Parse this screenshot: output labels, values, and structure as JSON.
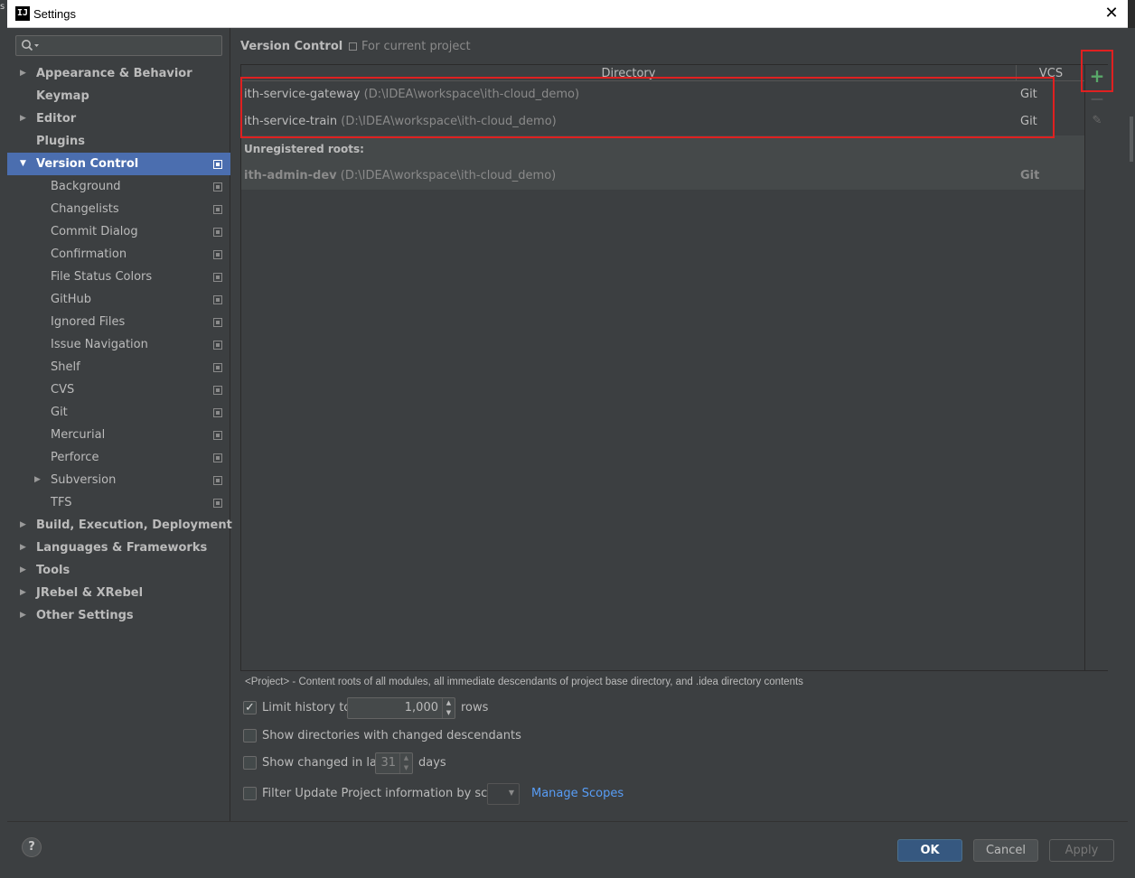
{
  "window": {
    "title": "Settings",
    "icon": "intellij-icon",
    "close": "✕"
  },
  "outer": {
    "left_char": "s"
  },
  "search": {
    "placeholder": "",
    "icon": "search-icon"
  },
  "sidebar": {
    "items": [
      {
        "label": "Appearance & Behavior",
        "expandable": true,
        "bold": true
      },
      {
        "label": "Keymap",
        "expandable": false,
        "bold": true
      },
      {
        "label": "Editor",
        "expandable": true,
        "bold": true
      },
      {
        "label": "Plugins",
        "expandable": false,
        "bold": true
      },
      {
        "label": "Version Control",
        "expanded": true,
        "bold": true,
        "selected": true,
        "project_scope": true
      },
      {
        "label": "Background",
        "child": true,
        "project_scope": true
      },
      {
        "label": "Changelists",
        "child": true,
        "project_scope": true
      },
      {
        "label": "Commit Dialog",
        "child": true,
        "project_scope": true
      },
      {
        "label": "Confirmation",
        "child": true,
        "project_scope": true
      },
      {
        "label": "File Status Colors",
        "child": true,
        "project_scope": true
      },
      {
        "label": "GitHub",
        "child": true,
        "project_scope": true
      },
      {
        "label": "Ignored Files",
        "child": true,
        "project_scope": true
      },
      {
        "label": "Issue Navigation",
        "child": true,
        "project_scope": true
      },
      {
        "label": "Shelf",
        "child": true,
        "project_scope": true
      },
      {
        "label": "CVS",
        "child": true,
        "project_scope": true
      },
      {
        "label": "Git",
        "child": true,
        "project_scope": true
      },
      {
        "label": "Mercurial",
        "child": true,
        "project_scope": true
      },
      {
        "label": "Perforce",
        "child": true,
        "project_scope": true
      },
      {
        "label": "Subversion",
        "child": true,
        "expandable": true,
        "project_scope": true
      },
      {
        "label": "TFS",
        "child": true,
        "project_scope": true
      },
      {
        "label": "Build, Execution, Deployment",
        "expandable": true,
        "bold": true
      },
      {
        "label": "Languages & Frameworks",
        "expandable": true,
        "bold": true
      },
      {
        "label": "Tools",
        "expandable": true,
        "bold": true
      },
      {
        "label": "JRebel & XRebel",
        "expandable": true,
        "bold": true
      },
      {
        "label": "Other Settings",
        "expandable": true,
        "bold": true
      }
    ]
  },
  "content": {
    "title": "Version Control",
    "scope": "For current project",
    "table": {
      "columns": [
        "Directory",
        "VCS"
      ],
      "rows": [
        {
          "name": "ith-service-gateway",
          "path": "(D:\\IDEA\\workspace\\ith-cloud_demo)",
          "vcs": "Git"
        },
        {
          "name": "ith-service-train",
          "path": "(D:\\IDEA\\workspace\\ith-cloud_demo)",
          "vcs": "Git"
        }
      ],
      "unregistered_label": "Unregistered roots:",
      "unregistered": [
        {
          "name": "ith-admin-dev",
          "path": "(D:\\IDEA\\workspace\\ith-cloud_demo)",
          "vcs": "Git"
        }
      ],
      "toolbar": {
        "add": "+",
        "remove": "—",
        "edit": "✎"
      }
    },
    "hint": "<Project> - Content roots of all modules, all immediate descendants of project base directory, and .idea directory contents",
    "options": {
      "limit_history": {
        "label": "Limit history to:",
        "checked": true,
        "value": "1,000",
        "suffix": "rows"
      },
      "show_dirs": {
        "label": "Show directories with changed descendants",
        "checked": false
      },
      "show_changed": {
        "label": "Show changed in last",
        "checked": false,
        "value": "31",
        "suffix": "days"
      },
      "filter_update": {
        "label": "Filter Update Project information by scope",
        "checked": false,
        "link": "Manage Scopes"
      }
    }
  },
  "footer": {
    "help": "?",
    "ok": "OK",
    "cancel": "Cancel",
    "apply": "Apply"
  },
  "colors": {
    "accent": "#4b6eaf",
    "ok_button": "#365880",
    "add_icon": "#59a869",
    "link": "#589df6",
    "annotation": "#e02020"
  }
}
